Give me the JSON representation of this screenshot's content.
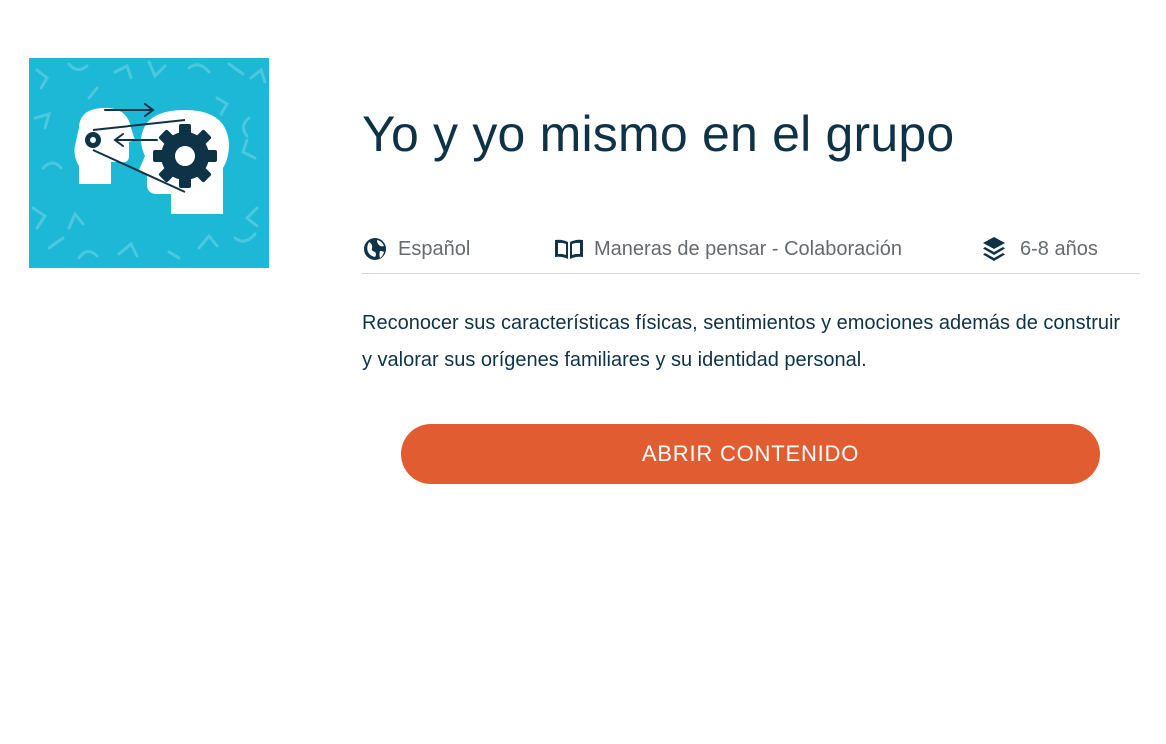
{
  "course": {
    "title": "Yo y yo mismo en el grupo",
    "thumbnail_icon": "mind-gears-icon",
    "thumbnail_color": "#1cb8d6"
  },
  "meta": {
    "language": {
      "icon": "globe-icon",
      "label": "Español"
    },
    "subject": {
      "icon": "book-icon",
      "label": "Maneras de pensar - Colaboración"
    },
    "age": {
      "icon": "layers-icon",
      "label": "6-8 años"
    }
  },
  "description": "Reconocer sus características físicas, sentimientos y emociones además de construir y valorar sus orígenes familiares y su identidad personal.",
  "actions": {
    "open_label": "ABRIR CONTENIDO",
    "button_color": "#e15d31"
  },
  "colors": {
    "heading": "#0e3347",
    "meta_text": "#666a6e"
  }
}
